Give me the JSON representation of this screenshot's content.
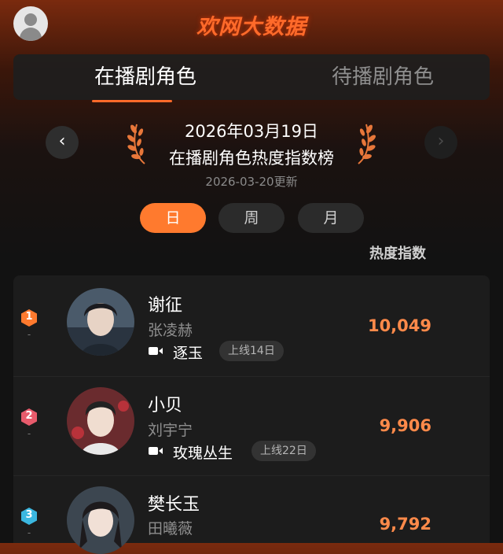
{
  "header": {
    "logo_text": "欢网大数据"
  },
  "tabs": [
    {
      "label": "在播剧角色",
      "active": true
    },
    {
      "label": "待播剧角色",
      "active": false
    }
  ],
  "ranking": {
    "date": "2026年03月19日",
    "title": "在播剧角色热度指数榜",
    "updated": "2026-03-20更新",
    "prev_icon": "chevron-left-icon",
    "next_icon": "chevron-right-icon",
    "prev_glyph": "‹",
    "next_glyph": "›"
  },
  "periods": [
    {
      "label": "日",
      "active": true
    },
    {
      "label": "周",
      "active": false
    },
    {
      "label": "月",
      "active": false
    }
  ],
  "column_header": "热度指数",
  "colors": {
    "accent": "#ff7a2e",
    "heat": "#ff8a4a",
    "rank1": "#ff7a2e",
    "rank2": "#e85b6c",
    "rank3": "#3bb7e0"
  },
  "entries": [
    {
      "rank": "1",
      "change": "-",
      "character": "谢征",
      "actor": "张凌赫",
      "drama": "逐玉",
      "aired": "上线14日",
      "heat": "10,049"
    },
    {
      "rank": "2",
      "change": "-",
      "character": "小贝",
      "actor": "刘宇宁",
      "drama": "玫瑰丛生",
      "aired": "上线22日",
      "heat": "9,906"
    },
    {
      "rank": "3",
      "change": "-",
      "character": "樊长玉",
      "actor": "田曦薇",
      "drama": "",
      "aired": "",
      "heat": "9,792"
    }
  ]
}
